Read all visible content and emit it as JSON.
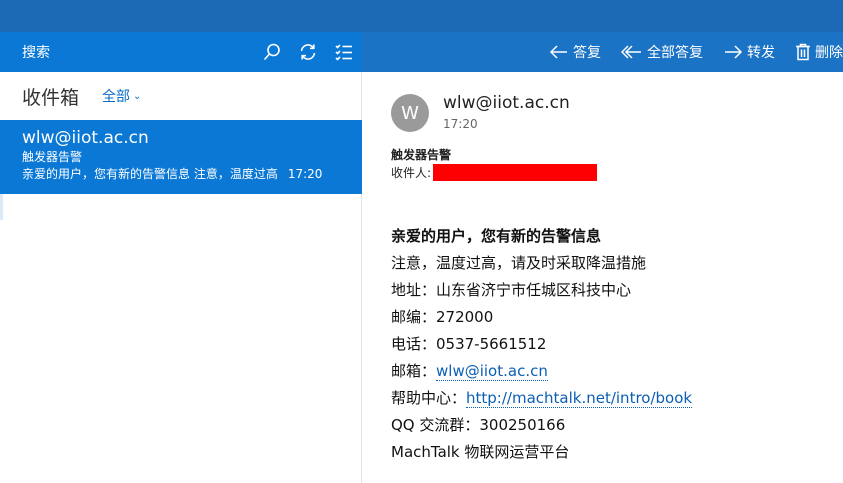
{
  "toolbar": {
    "search_label": "搜索",
    "actions": {
      "reply": "答复",
      "reply_all": "全部答复",
      "forward": "转发",
      "delete": "删除"
    }
  },
  "folder": {
    "title": "收件箱",
    "filter": "全部"
  },
  "message_list": [
    {
      "from": "wlw@iiot.ac.cn",
      "subject": "触发器告警",
      "preview": "亲爱的用户，您有新的告警信息 注意，温度过高",
      "time": "17:20"
    }
  ],
  "reading": {
    "avatar_letter": "W",
    "sender": "wlw@iiot.ac.cn",
    "time": "17:20",
    "subject": "触发器告警",
    "recipient_label": "收件人:",
    "body": {
      "greeting": "亲爱的用户，您有新的告警信息",
      "line1": "注意，温度过高，请及时采取降温措施",
      "line2": "地址：山东省济宁市任城区科技中心",
      "line3": "邮编：272000",
      "line4": "电话：0537-5661512",
      "email_label": "邮箱：",
      "email_link": "wlw@iiot.ac.cn",
      "help_label": "帮助中心：",
      "help_link": "http://machtalk.net/intro/book",
      "line7": "QQ 交流群：300250166",
      "line8": "MachTalk 物联网运营平台"
    }
  },
  "colors": {
    "titlebar": "#1c6ab5",
    "accent": "#0b78d6",
    "redaction": "#ff0000",
    "link": "#0b5fb5"
  }
}
